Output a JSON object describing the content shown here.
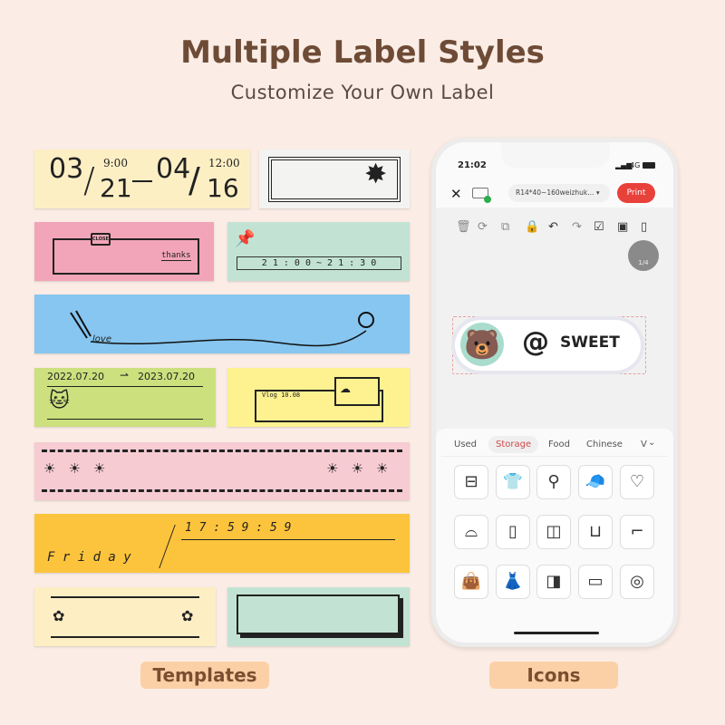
{
  "header": {
    "title": "Multiple Label Styles",
    "subtitle": "Customize Your Own Label"
  },
  "templates": {
    "date_range": {
      "m1": "03",
      "d1": "21",
      "t1": "9:00",
      "m2": "04",
      "d2": "16",
      "t2": "12:00"
    },
    "close_sign": "CLOSE",
    "thanks": "thanks",
    "time_range": "2 1 : 0 0 ~ 2 1 : 3 0",
    "love": "love",
    "date_span": {
      "from": "2022.07.20",
      "to": "2023.07.20"
    },
    "vlog": "Vlog 10.08",
    "weekday": "F r i d a y",
    "clock": "1 7 : 5 9 : 5 9"
  },
  "captions": {
    "templates": "Templates",
    "icons": "Icons"
  },
  "phone": {
    "time": "21:02",
    "network": "4G",
    "template_select": "R14*40~160weizhuk...",
    "print_label": "Print",
    "page_indicator": "1/4",
    "label_text": "SWEET",
    "tabs": [
      {
        "label": "Used"
      },
      {
        "label": "Storage",
        "active": true
      },
      {
        "label": "Food"
      },
      {
        "label": "Chinese"
      },
      {
        "label": "V"
      }
    ],
    "icons": [
      "box-icon",
      "sweater-icon",
      "lamp-icon",
      "cap-icon",
      "tshirt-icon",
      "hat-icon",
      "fridge-icon",
      "toilet-paper-icon",
      "toothbrush-cup-icon",
      "boot-icon",
      "handbag-icon",
      "dress-icon",
      "wardrobe-icon",
      "microwave-icon",
      "washing-machine-icon"
    ],
    "accent": "#e8413a"
  },
  "colors": {
    "title": "#6e4b36",
    "pill": "#fcd0a6"
  }
}
